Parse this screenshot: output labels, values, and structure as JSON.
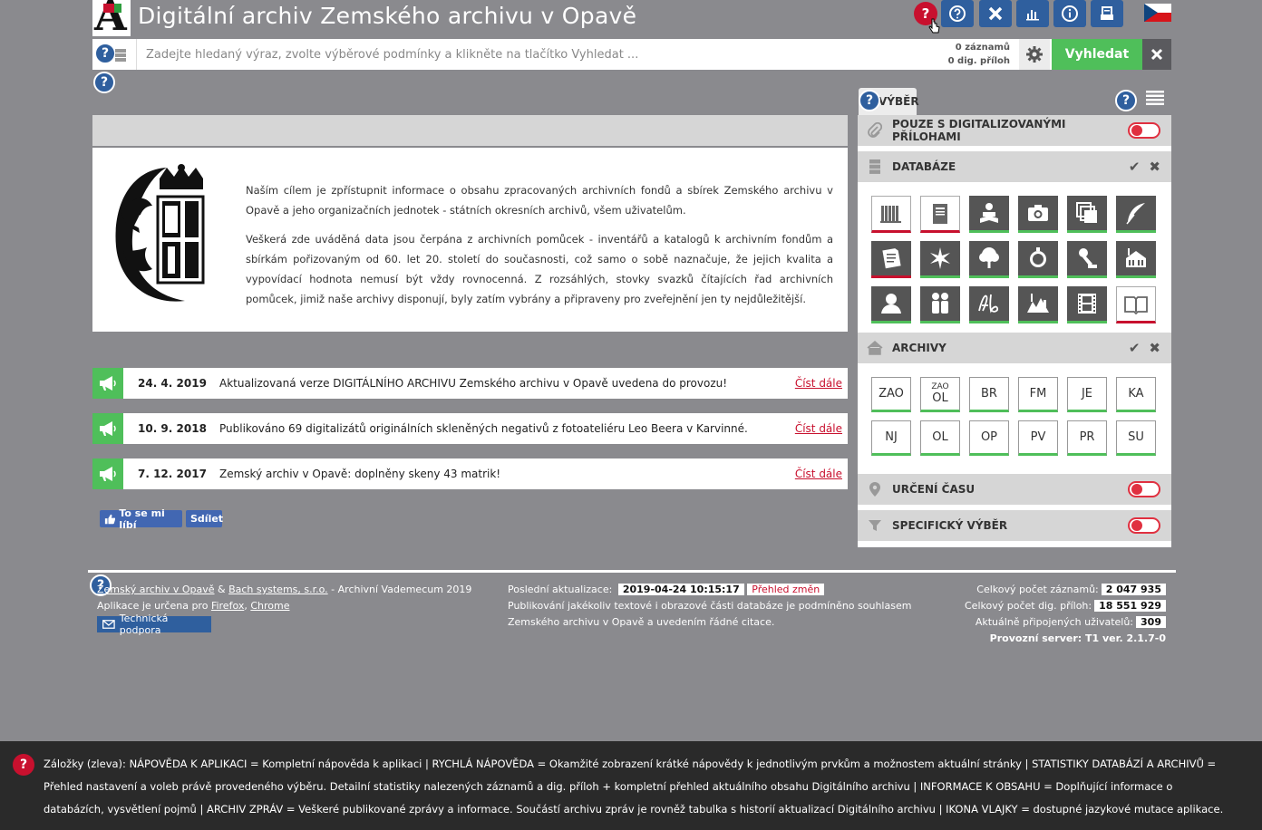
{
  "header": {
    "title": "Digitální archiv  Zemského archivu v Opavě",
    "help_glyph": "?",
    "toolbar_icons": [
      "question-circle-icon",
      "close-icon",
      "bar-chart-icon",
      "info-icon",
      "archive-icon"
    ]
  },
  "search": {
    "placeholder": "Zadejte hledaný výraz, zvolte výběrové podmínky a klikněte na tlačítko Vyhledat ...",
    "records_count": "0 záznamů",
    "attachments_count": "0 dig. příloh",
    "search_label": "Vyhledat"
  },
  "intro": {
    "p1": "Naším cílem je zpřístupnit informace o obsahu zpracovaných archivních fondů a sbírek Zemského archivu v Opavě a jeho organizačních jednotek - státních okresních archivů, všem uživatelům.",
    "p2": "Veškerá zde uváděná data jsou čerpána z archivních pomůcek - inventářů a katalogů k archivním fondům a sbírkám pořizovaným od 60. let 20. století do současnosti, což samo o sobě naznačuje, že jejich kvalita a vypovídací hodnota nemusí být vždy rovnocenná. Z rozsáhlých, stovky svazků čítajících řad archivních pomůcek, jimiž naše archivy disponují, byly zatím vybrány a připraveny pro zveřejnění jen ty nejdůležitější."
  },
  "news": [
    {
      "date": "24. 4. 2019",
      "text": "Aktualizovaná verze DIGITÁLNÍHO ARCHIVU Zemského archivu v Opavě uvedena do provozu!",
      "more": "Číst dále"
    },
    {
      "date": "10. 9. 2018",
      "text": "Publikováno 69 digitalizátů originálních skleněných negativů z fotoateliéru Leo Beera v Karvinné.",
      "more": "Číst dále"
    },
    {
      "date": "7. 12. 2017",
      "text": "Zemský archiv v Opavě: doplněny skeny 43 matrik!",
      "more": "Číst dále"
    }
  ],
  "social": {
    "like": "To se mi líbí",
    "share": "Sdílet"
  },
  "panel": {
    "tab_label": "VÝBĚR",
    "only_digitized": "POUZE S DIGITALIZOVANÝMI PŘÍLOHAMI",
    "databases": "DATABÁZE",
    "archives": "ARCHIVY",
    "time": "URČENÍ ČASU",
    "specific": "SPECIFICKÝ VÝBĚR",
    "check_glyph": "✔",
    "close_glyph": "✖",
    "archive_codes": [
      {
        "top": "",
        "code": "ZAO"
      },
      {
        "top": "ZAO",
        "code": "OL"
      },
      {
        "top": "",
        "code": "BR"
      },
      {
        "top": "",
        "code": "FM"
      },
      {
        "top": "",
        "code": "JE"
      },
      {
        "top": "",
        "code": "KA"
      },
      {
        "top": "",
        "code": "NJ"
      },
      {
        "top": "",
        "code": "OL"
      },
      {
        "top": "",
        "code": "OP"
      },
      {
        "top": "",
        "code": "PV"
      },
      {
        "top": "",
        "code": "PR"
      },
      {
        "top": "",
        "code": "SU"
      }
    ]
  },
  "footer": {
    "org1": "Zemský archiv v Opavě",
    "amp": " & ",
    "org2": "Bach systems, s.r.o.",
    "vademecum": " - Archivní Vademecum 2019",
    "browsers_prefix": "Aplikace je určena pro ",
    "firefox": "Firefox",
    "comma": ", ",
    "chrome": "Chrome",
    "support": "Technická podpora",
    "last_update_label": "Poslední aktualizace:",
    "last_update_value": "2019-04-24 10:15:17",
    "changes": "Přehled změn",
    "notice": "Publikování jakékoliv textové i obrazové části databáze je podmíněno souhlasem Zemského archivu v Opavě a uvedením řádné citace.",
    "total_records_label": "Celkový počet záznamů:",
    "total_records": "2 047 935",
    "total_attachments_label": "Celkový počet dig. příloh:",
    "total_attachments": "18 551 929",
    "users_label": "Aktuálně připojených uživatelů:",
    "users": "309",
    "server": "Provozní server: T1 ver. 2.1.7-0"
  },
  "helpbar": {
    "text": "Záložky (zleva): NÁPOVĚDA K APLIKACI = Kompletní nápověda k aplikaci | RYCHLÁ NÁPOVĚDA = Okamžité zobrazení krátké nápovědy k jednotlivým prvkům a možnostem aktuální stránky | STATISTIKY DATABÁZÍ A ARCHIVŮ = Přehled nastavení a voleb právě provedeného výběru. Detailní statistiky nalezených záznamů a dig. příloh + kompletní přehled aktuálního obsahu Digitálního archivu | INFORMACE K OBSAHU = Doplňující informace o databázích, vysvětlení pojmů | ARCHIV ZPRÁV = Veškeré publikované zprávy a informace. Součástí archivu zpráv je rovněž tabulka s historií aktualizací Digitálního archivu | IKONA VLAJKY = dostupné jazykové mutace aplikace."
  },
  "colors": {
    "accent_blue": "#2f5f9e",
    "green": "#4fbf5a",
    "red": "#c8102e",
    "background": "#8a8a8e"
  }
}
